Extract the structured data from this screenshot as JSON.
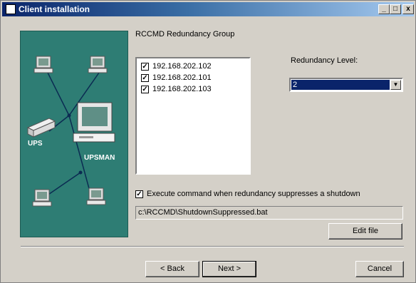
{
  "window": {
    "title": "Client installation",
    "controls": {
      "minimize": "_",
      "maximize": "□",
      "close": "x"
    }
  },
  "graphic": {
    "ups_label": "UPS",
    "upsman_label": "UPSMAN"
  },
  "redundancy_group": {
    "label": "RCCMD Redundancy Group",
    "items": [
      {
        "address": "192.168.202.102",
        "checked": true
      },
      {
        "address": "192.168.202.101",
        "checked": true
      },
      {
        "address": "192.168.202.103",
        "checked": true
      }
    ]
  },
  "redundancy_level": {
    "label": "Redundancy Level:",
    "value": "2",
    "arrow": "▼"
  },
  "execute": {
    "checked": true,
    "label": "Execute command when redundancy suppresses a shutdown",
    "path": "c:\\RCCMD\\ShutdownSuppressed.bat",
    "edit_label": "Edit file"
  },
  "footer": {
    "back_label": "< Back",
    "next_label": "Next >",
    "cancel_label": "Cancel"
  }
}
